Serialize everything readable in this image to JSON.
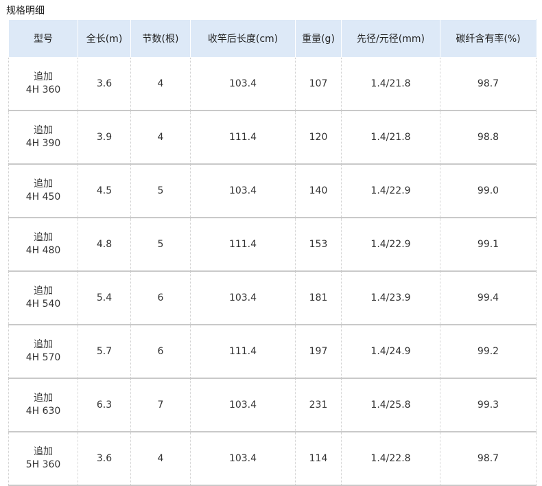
{
  "page": {
    "title": "规格明细"
  },
  "table": {
    "headers": [
      "型号",
      "全长(m)",
      "节数(根)",
      "收竿后长度(cm)",
      "重量(g)",
      "先径/元径(mm)",
      "碳纤含有率(%)"
    ],
    "rows": [
      {
        "model_line1": "追加",
        "model_line2": "4H 360",
        "length": "3.6",
        "sections": "4",
        "closed_length": "103.4",
        "weight": "107",
        "tip_butt": "1.4/21.8",
        "carbon": "98.7"
      },
      {
        "model_line1": "追加",
        "model_line2": "4H 390",
        "length": "3.9",
        "sections": "4",
        "closed_length": "111.4",
        "weight": "120",
        "tip_butt": "1.4/21.8",
        "carbon": "98.8"
      },
      {
        "model_line1": "追加",
        "model_line2": "4H 450",
        "length": "4.5",
        "sections": "5",
        "closed_length": "103.4",
        "weight": "140",
        "tip_butt": "1.4/22.9",
        "carbon": "99.0"
      },
      {
        "model_line1": "追加",
        "model_line2": "4H 480",
        "length": "4.8",
        "sections": "5",
        "closed_length": "111.4",
        "weight": "153",
        "tip_butt": "1.4/22.9",
        "carbon": "99.1"
      },
      {
        "model_line1": "追加",
        "model_line2": "4H 540",
        "length": "5.4",
        "sections": "6",
        "closed_length": "103.4",
        "weight": "181",
        "tip_butt": "1.4/23.9",
        "carbon": "99.4"
      },
      {
        "model_line1": "追加",
        "model_line2": "4H 570",
        "length": "5.7",
        "sections": "6",
        "closed_length": "111.4",
        "weight": "197",
        "tip_butt": "1.4/24.9",
        "carbon": "99.2"
      },
      {
        "model_line1": "追加",
        "model_line2": "4H 630",
        "length": "6.3",
        "sections": "7",
        "closed_length": "103.4",
        "weight": "231",
        "tip_butt": "1.4/25.8",
        "carbon": "99.3"
      },
      {
        "model_line1": "追加",
        "model_line2": "5H 360",
        "length": "3.6",
        "sections": "4",
        "closed_length": "103.4",
        "weight": "114",
        "tip_butt": "1.4/22.8",
        "carbon": "98.7"
      }
    ]
  },
  "colors": {
    "header_bg": "#dde9f7",
    "row_border": "#c9c9c9"
  }
}
